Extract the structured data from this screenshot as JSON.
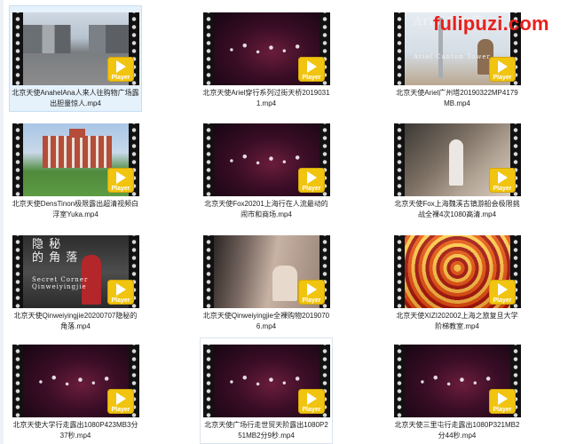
{
  "watermark": "fulipuzi.com",
  "files": [
    {
      "name": "北京天使AnahelAna人来人往购物广场露出胆量惊人.mp4",
      "thumbnail": "street",
      "selected": true
    },
    {
      "name": "北京天使Ariel穿行系列过街天桥20190311.mp4",
      "thumbnail": "dark"
    },
    {
      "name": "北京天使Ariel广州塔20190322MP4179MB.mp4",
      "thumbnail": "tower",
      "poster_title": "Ariel广州塔",
      "poster_sub": "Ariel Canton Tower"
    },
    {
      "name": "北京天使DensTinon极限露出超清视频白浮室Yuka.mp4",
      "thumbnail": "building"
    },
    {
      "name": "北京天使Fox20201上海行在人流最动的闹市和商场.mp4",
      "thumbnail": "dark"
    },
    {
      "name": "北京天使Fox上海魏溪古镇游船会极限挑战全裸4次1080高清.mp4",
      "thumbnail": "boat"
    },
    {
      "name": "北京天使Qinweiyingjie20200707隐秘的角落.mp4",
      "thumbnail": "forest",
      "poster_title": "隐 秘\n的 角 落",
      "poster_sub": "Secret Corner\nQinweiyingjie"
    },
    {
      "name": "北京天使Qinweiyingjie全裸购物20190706.mp4",
      "thumbnail": "sepia"
    },
    {
      "name": "北京天使XIZI202002上海之旅复旦大学阶梯教室.mp4",
      "thumbnail": "orange"
    },
    {
      "name": "北京天使大学行走露出1080P423MB3分37秒.mp4",
      "thumbnail": "dark"
    },
    {
      "name": "北京天使广场行走世贸天阶露出1080P251MB2分9秒.mp4",
      "thumbnail": "dark",
      "hover": true
    },
    {
      "name": "北京天使三里屯行走露出1080P321MB2分44秒.mp4",
      "thumbnail": "dark"
    }
  ],
  "badge_label": "Player",
  "badge_color": "#f1c40f",
  "icons": {
    "badge": "play-triangle-icon"
  }
}
